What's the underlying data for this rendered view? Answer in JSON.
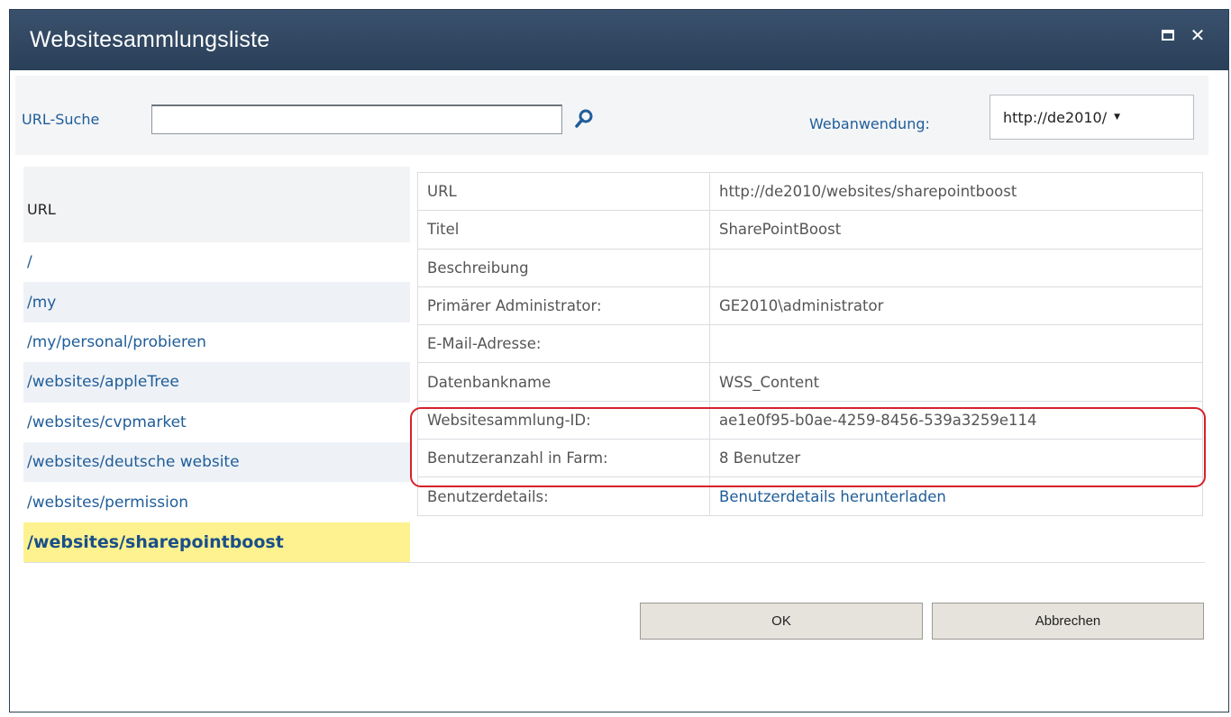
{
  "dialog": {
    "title": "Websitesammlungsliste",
    "maximize_icon": "maximize-icon",
    "close_icon": "close-icon"
  },
  "search": {
    "label": "URL-Suche",
    "value": "",
    "placeholder": "",
    "icon": "search-icon",
    "webapp_label": "Webanwendung:",
    "webapp_value": "http://de2010/"
  },
  "url_list": {
    "header": "URL",
    "items": [
      {
        "label": "/"
      },
      {
        "label": "/my"
      },
      {
        "label": "/my/personal/probieren"
      },
      {
        "label": "/websites/appleTree"
      },
      {
        "label": "/websites/cvpmarket"
      },
      {
        "label": "/websites/deutsche website"
      },
      {
        "label": "/websites/permission"
      },
      {
        "label": "/websites/sharepointboost"
      }
    ],
    "selected": "/websites/sharepointboost"
  },
  "details": {
    "rows": [
      {
        "key": "URL",
        "value": "http://de2010/websites/sharepointboost"
      },
      {
        "key": "Titel",
        "value": "SharePointBoost"
      },
      {
        "key": "Beschreibung",
        "value": ""
      },
      {
        "key": "Primärer Administrator:",
        "value": "GE2010\\administrator"
      },
      {
        "key": "E-Mail-Adresse:",
        "value": ""
      },
      {
        "key": "Datenbankname",
        "value": "WSS_Content"
      },
      {
        "key": "Websitesammlung-ID:",
        "value": "ae1e0f95-b0ae-4259-8456-539a3259e114"
      },
      {
        "key": "Benutzeranzahl in Farm:",
        "value": "8 Benutzer"
      },
      {
        "key": "Benutzerdetails:",
        "value": "Benutzerdetails herunterladen"
      }
    ]
  },
  "buttons": {
    "ok": "OK",
    "cancel": "Abbrechen"
  },
  "colors": {
    "titlebar": "#2f4560",
    "link": "#1f5d99",
    "selected_bg": "#fdf28f",
    "highlight": "#d6212a"
  }
}
